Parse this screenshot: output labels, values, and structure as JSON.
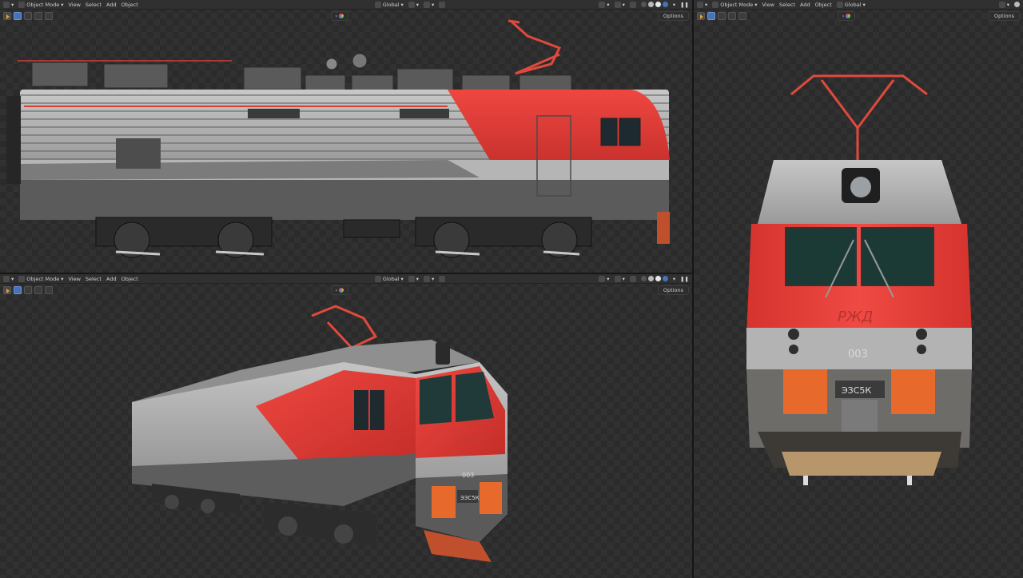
{
  "header": {
    "mode_label": "Object Mode",
    "menu_view": "View",
    "menu_select": "Select",
    "menu_add": "Add",
    "menu_object": "Object",
    "orientation": "Global",
    "options_label": "Options"
  },
  "locomotive": {
    "logo": "РЖД",
    "number": "003",
    "model": "ЭЗС5К"
  },
  "colors": {
    "body_red": "#e23b36",
    "body_silver": "#a9a9a9",
    "body_dark": "#5b5b5b",
    "pantograph": "#e04a3c",
    "buffer_orange": "#e8692c",
    "accent_blue": "#4772b3"
  }
}
